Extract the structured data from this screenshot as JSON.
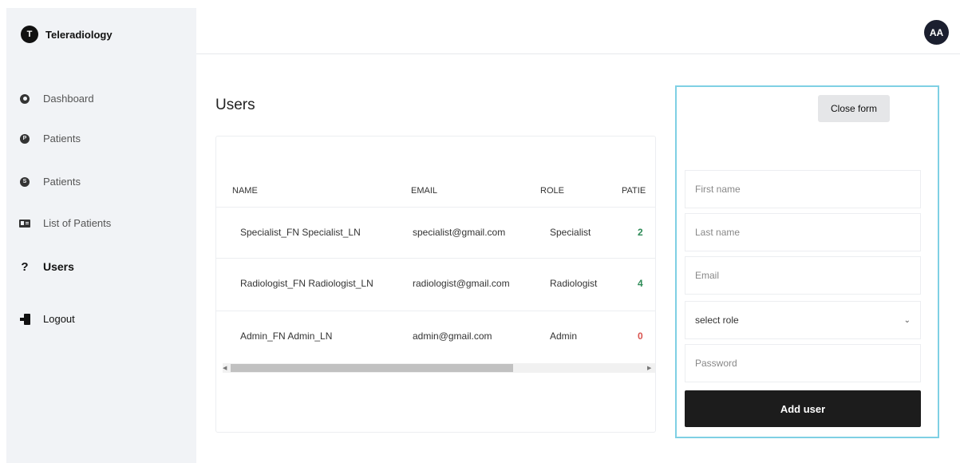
{
  "app": {
    "logo_letter": "T",
    "name": "Teleradiology"
  },
  "sidebar": {
    "items": [
      {
        "label": "Dashboard"
      },
      {
        "label": "Patients",
        "icon_text": "P"
      },
      {
        "label": "Patients",
        "icon_text": "S"
      },
      {
        "label": "List of Patients"
      },
      {
        "label": "Users",
        "icon_text": "?"
      },
      {
        "label": "Logout"
      }
    ]
  },
  "header": {
    "avatar": "AA"
  },
  "main": {
    "title": "Users",
    "table": {
      "columns": [
        "NAME",
        "EMAIL",
        "ROLE",
        "PATIE"
      ],
      "rows": [
        {
          "name": "Specialist_FN Specialist_LN",
          "email": "specialist@gmail.com",
          "role": "Specialist",
          "patients": "2",
          "patients_color": "#2e8b57"
        },
        {
          "name": "Radiologist_FN Radiologist_LN",
          "email": "radiologist@gmail.com",
          "role": "Radiologist",
          "patients": "4",
          "patients_color": "#2e8b57"
        },
        {
          "name": "Admin_FN Admin_LN",
          "email": "admin@gmail.com",
          "role": "Admin",
          "patients": "0",
          "patients_color": "#d9534f"
        }
      ]
    }
  },
  "form": {
    "close_label": "Close form",
    "first_name_placeholder": "First name",
    "last_name_placeholder": "Last name",
    "email_placeholder": "Email",
    "role_selected": "select role",
    "password_placeholder": "Password",
    "submit_label": "Add user"
  }
}
